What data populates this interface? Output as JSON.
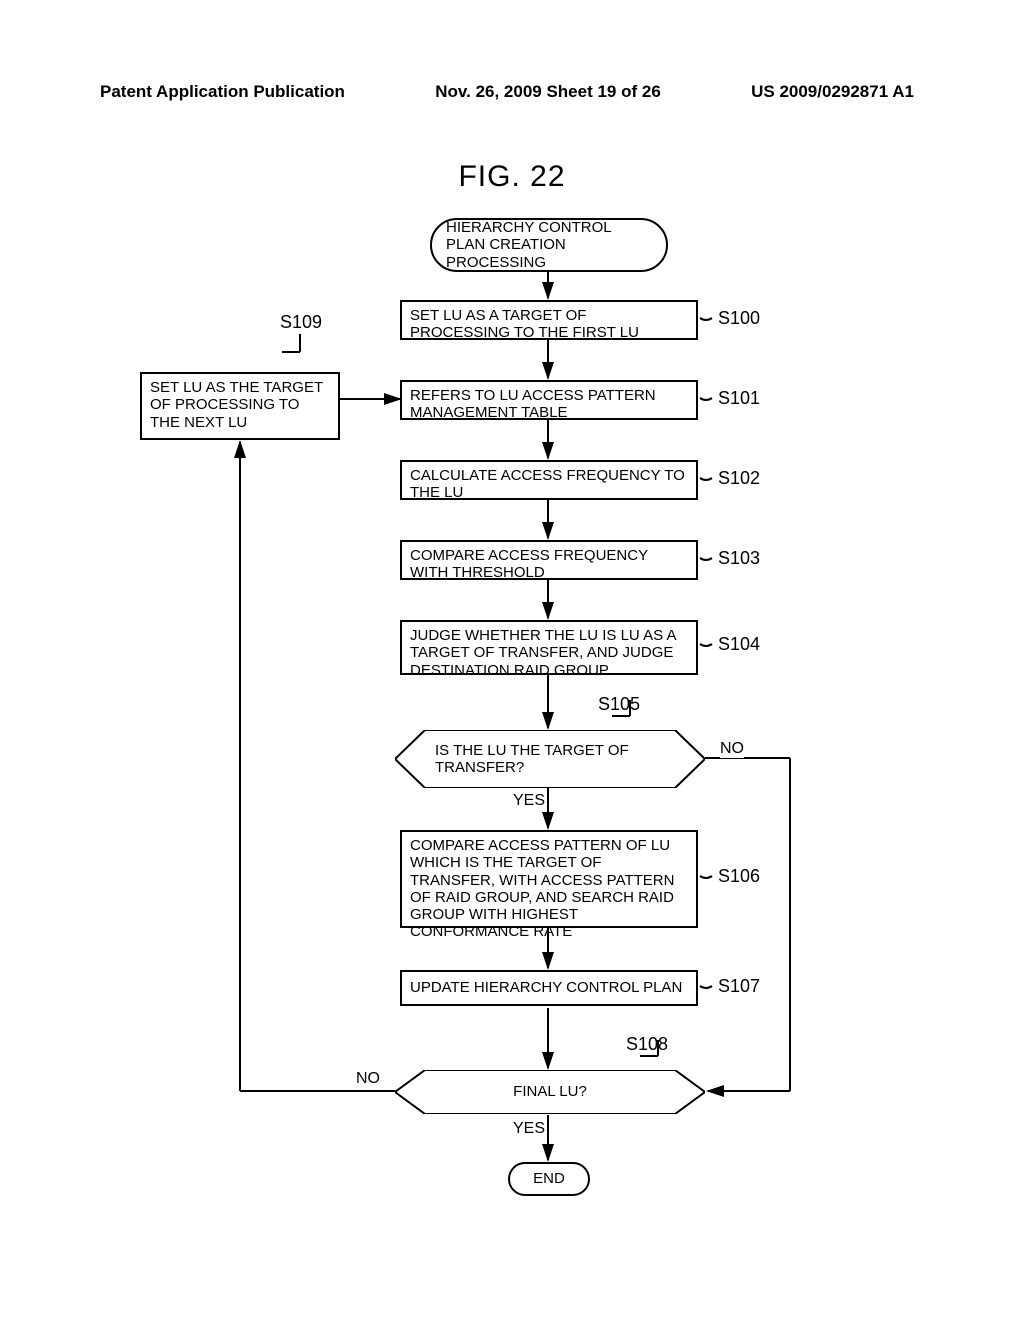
{
  "header": {
    "left": "Patent Application Publication",
    "center": "Nov. 26, 2009  Sheet 19 of 26",
    "right": "US 2009/0292871 A1"
  },
  "figure_title": "FIG. 22",
  "terminator_start": "HIERARCHY CONTROL PLAN CREATION PROCESSING",
  "terminator_end": "END",
  "steps": {
    "s100": {
      "text": "SET LU AS A TARGET OF PROCESSING TO THE FIRST LU",
      "id": "S100"
    },
    "s101": {
      "text": "REFERS TO LU ACCESS PATTERN MANAGEMENT TABLE",
      "id": "S101"
    },
    "s102": {
      "text": "CALCULATE ACCESS FREQUENCY TO THE LU",
      "id": "S102"
    },
    "s103": {
      "text": "COMPARE ACCESS FREQUENCY WITH THRESHOLD",
      "id": "S103"
    },
    "s104": {
      "text": "JUDGE WHETHER THE LU IS LU AS A TARGET OF TRANSFER, AND JUDGE DESTINATION RAID GROUP",
      "id": "S104"
    },
    "s105": {
      "text": "IS THE LU THE TARGET OF TRANSFER?",
      "id": "S105",
      "yes": "YES",
      "no": "NO"
    },
    "s106": {
      "text": "COMPARE ACCESS PATTERN OF LU WHICH IS THE TARGET OF TRANSFER, WITH ACCESS PATTERN OF RAID GROUP, AND SEARCH RAID GROUP WITH HIGHEST CONFORMANCE RATE",
      "id": "S106"
    },
    "s107": {
      "text": "UPDATE HIERARCHY CONTROL PLAN",
      "id": "S107"
    },
    "s108": {
      "text": "FINAL LU?",
      "id": "S108",
      "yes": "YES",
      "no": "NO"
    },
    "s109": {
      "text": "SET LU AS THE TARGET OF PROCESSING TO THE NEXT LU",
      "id": "S109"
    }
  }
}
